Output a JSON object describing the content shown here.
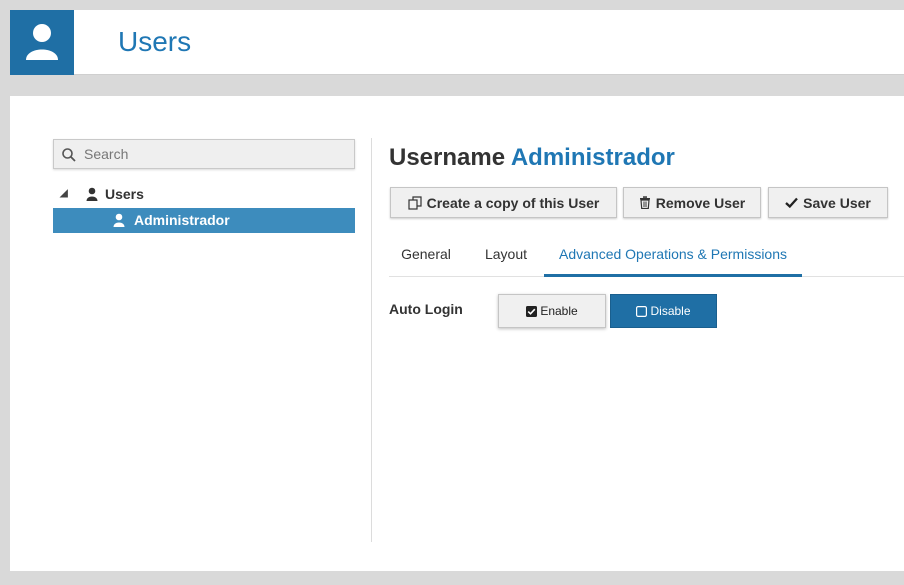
{
  "app": {
    "title": "Users",
    "icon": "user-icon"
  },
  "sidebar": {
    "search_placeholder": "Search",
    "tree": {
      "root_label": "Users",
      "selected_child_label": "Administrador"
    }
  },
  "detail": {
    "heading_prefix": "Username",
    "heading_name": "Administrador",
    "buttons": {
      "copy_label": "Create a copy of this User",
      "remove_label": "Remove User",
      "save_label": "Save User"
    },
    "tabs": [
      {
        "label": "General",
        "active": false
      },
      {
        "label": "Layout",
        "active": false
      },
      {
        "label": "Advanced Operations & Permissions",
        "active": true
      }
    ],
    "auto_login": {
      "label": "Auto Login",
      "enable_label": "Enable",
      "disable_label": "Disable",
      "selected": "Disable"
    }
  },
  "colors": {
    "accent": "#1f77b4",
    "header_icon_bg": "#1f6fa5",
    "tree_selected_bg": "#3d8cbd"
  }
}
